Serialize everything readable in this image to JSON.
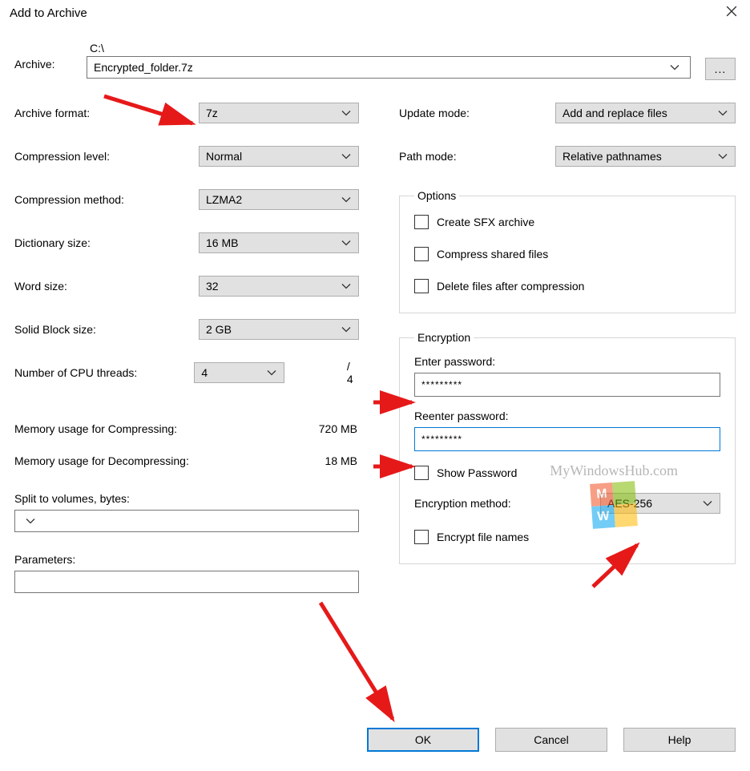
{
  "title": "Add to Archive",
  "archive": {
    "label": "Archive:",
    "path": "C:\\",
    "filename": "Encrypted_folder.7z",
    "browse": "..."
  },
  "left": {
    "format_label": "Archive format:",
    "format_value": "7z",
    "level_label": "Compression level:",
    "level_value": "Normal",
    "method_label": "Compression method:",
    "method_value": "LZMA2",
    "dict_label": "Dictionary size:",
    "dict_value": "16 MB",
    "word_label": "Word size:",
    "word_value": "32",
    "solid_label": "Solid Block size:",
    "solid_value": "2 GB",
    "cpu_label": "Number of CPU threads:",
    "cpu_value": "4",
    "cpu_total": "/ 4",
    "mem_comp_label": "Memory usage for Compressing:",
    "mem_comp_value": "720 MB",
    "mem_decomp_label": "Memory usage for Decompressing:",
    "mem_decomp_value": "18 MB",
    "split_label": "Split to volumes, bytes:",
    "params_label": "Parameters:"
  },
  "right": {
    "update_label": "Update mode:",
    "update_value": "Add and replace files",
    "path_label": "Path mode:",
    "path_value": "Relative pathnames"
  },
  "options": {
    "legend": "Options",
    "sfx": "Create SFX archive",
    "shared": "Compress shared files",
    "delete": "Delete files after compression"
  },
  "encryption": {
    "legend": "Encryption",
    "enter_label": "Enter password:",
    "enter_value": "*********",
    "reenter_label": "Reenter password:",
    "reenter_value": "*********",
    "show": "Show Password",
    "method_label": "Encryption method:",
    "method_value": "AES-256",
    "names": "Encrypt file names"
  },
  "buttons": {
    "ok": "OK",
    "cancel": "Cancel",
    "help": "Help"
  },
  "watermark": "MyWindowsHub.com"
}
